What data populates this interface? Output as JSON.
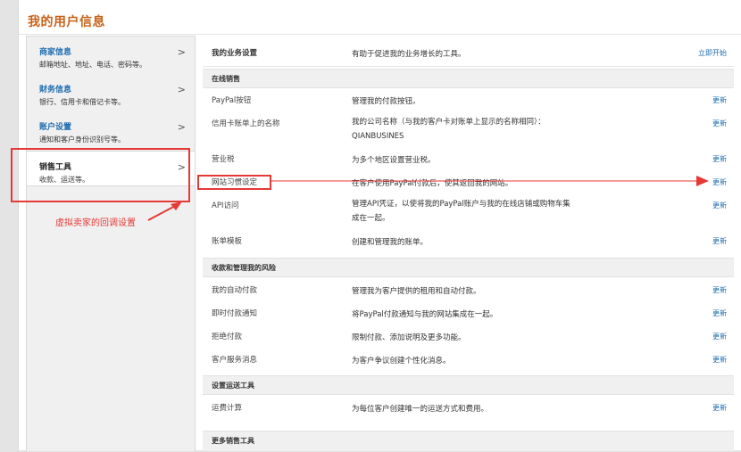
{
  "page": {
    "title": "我的用户信息"
  },
  "sidebar": {
    "items": [
      {
        "label": "商家信息",
        "desc": "邮箱地址、地址、电话、密码等。",
        "chevron": ">"
      },
      {
        "label": "财务信息",
        "desc": "银行、信用卡和借记卡等。",
        "chevron": ">"
      },
      {
        "label": "账户设置",
        "desc": "通知和客户身份识别号等。",
        "chevron": ">"
      },
      {
        "label": "销售工具",
        "desc": "收款、运送等。",
        "chevron": ">",
        "active": true
      }
    ]
  },
  "main": {
    "top": {
      "name": "我的业务设置",
      "desc": "有助于促进我的业务增长的工具。",
      "action": "立即开始"
    },
    "sections": [
      {
        "title": "在线销售",
        "rows": [
          {
            "name": "PayPal按钮",
            "desc": "管理我的付款按钮。",
            "action": "更新"
          },
          {
            "name": "信用卡账单上的名称",
            "desc": "我的公司名称（与我的客户卡对账单上显示的名称相同）：QIANBUSINES",
            "action": "更新"
          },
          {
            "name": "营业税",
            "desc": "为多个地区设置营业税。",
            "action": "更新"
          },
          {
            "name": "网站习惯设定",
            "desc": "在客户使用PayPal付款后，使其返回我的网站。",
            "action": "更新"
          },
          {
            "name": "API访问",
            "desc": "管理API凭证，以使将我的PayPal账户与我的在线店铺或购物车集成在一起。",
            "action": "更新"
          },
          {
            "name": "账单模板",
            "desc": "创建和管理我的账单。",
            "action": "更新"
          }
        ]
      },
      {
        "title": "收款和管理我的风险",
        "rows": [
          {
            "name": "我的自动付款",
            "desc": "管理我为客户提供的租用和自动付款。",
            "action": "更新"
          },
          {
            "name": "即时付款通知",
            "desc": "将PayPal付款通知与我的网站集成在一起。",
            "action": "更新"
          },
          {
            "name": "拒绝付款",
            "desc": "限制付款、添加说明及更多功能。",
            "action": "更新"
          },
          {
            "name": "客户服务消息",
            "desc": "为客户争议创建个性化消息。",
            "action": "更新"
          }
        ]
      },
      {
        "title": "设置运送工具",
        "rows": [
          {
            "name": "运费计算",
            "desc": "为每位客户创建唯一的运送方式和费用。",
            "action": "更新"
          }
        ]
      },
      {
        "title": "更多销售工具",
        "rows": []
      }
    ]
  },
  "annotations": {
    "callout": "虚拟卖家的回调设置",
    "color": "#e53935"
  },
  "colors": {
    "accent": "#c8621a",
    "link": "#1e6cb0",
    "section_bg": "#f0f0f0"
  }
}
